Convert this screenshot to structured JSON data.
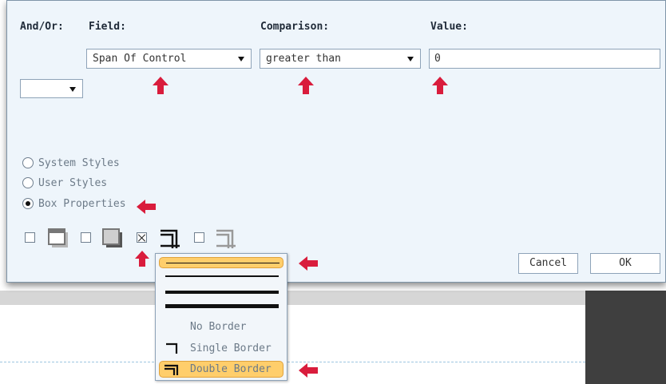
{
  "headers": {
    "and_or": "And/Or:",
    "field": "Field:",
    "comparison": "Comparison:",
    "value": "Value:"
  },
  "filter": {
    "and_or_value": "",
    "field_value": "Span Of Control",
    "comparison_value": "greater than",
    "value": "0"
  },
  "style_options": [
    {
      "label": "System Styles",
      "selected": false
    },
    {
      "label": "User Styles",
      "selected": false
    },
    {
      "label": "Box Properties",
      "selected": true
    }
  ],
  "box_options": [
    {
      "name": "shadow-1",
      "checked": false,
      "icon": "shadow-box-icon"
    },
    {
      "name": "shadow-2",
      "checked": false,
      "icon": "filled-shadow-box-icon"
    },
    {
      "name": "border",
      "checked": true,
      "icon": "double-corner-border-icon"
    },
    {
      "name": "border-2",
      "checked": false,
      "icon": "gray-double-corner-border-icon"
    }
  ],
  "border_menu": {
    "line_options": [
      "thin-line",
      "medium-line",
      "thick-line",
      "thicker-line"
    ],
    "items": [
      {
        "label": "No Border",
        "icon": "none"
      },
      {
        "label": "Single Border",
        "icon": "single-corner-icon"
      },
      {
        "label": "Double Border",
        "icon": "double-corner-icon",
        "highlighted": true
      }
    ]
  },
  "buttons": {
    "cancel": "Cancel",
    "ok": "OK"
  },
  "colors": {
    "highlight": "#ffce6b",
    "arrow": "#d91c3c",
    "dialog_bg": "#eef5fb"
  }
}
